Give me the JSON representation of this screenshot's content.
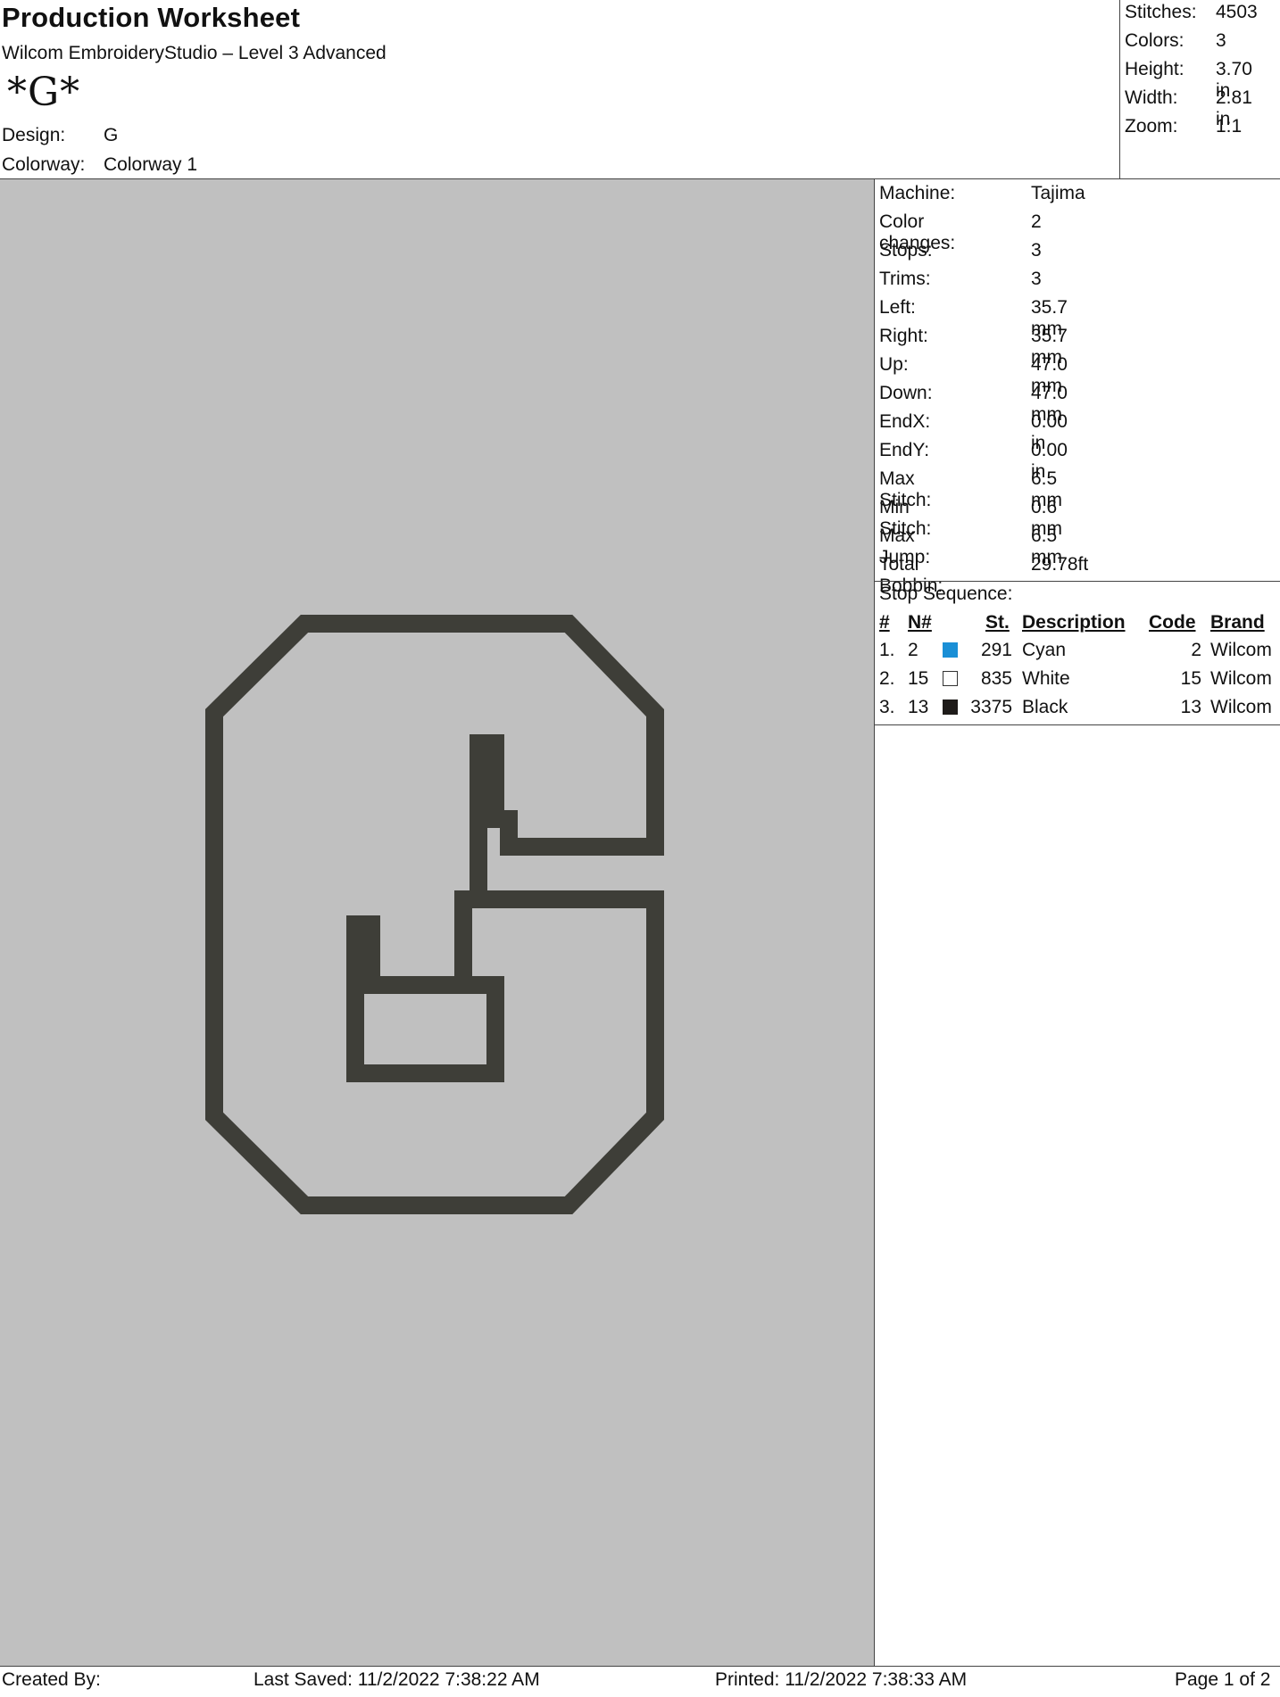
{
  "header": {
    "title": "Production Worksheet",
    "subtitle": "Wilcom EmbroideryStudio – Level 3 Advanced",
    "symbol": "*G*",
    "design_label": "Design:",
    "design_value": "G",
    "colorway_label": "Colorway:",
    "colorway_value": "Colorway 1"
  },
  "summary": [
    {
      "label": "Stitches:",
      "value": "4503"
    },
    {
      "label": "Colors:",
      "value": "3"
    },
    {
      "label": "Height:",
      "value": "3.70 in"
    },
    {
      "label": "Width:",
      "value": "2.81 in"
    },
    {
      "label": "Zoom:",
      "value": "1:1"
    }
  ],
  "info": [
    {
      "label": "Machine:",
      "value": "Tajima"
    },
    {
      "label": "Color changes:",
      "value": "2"
    },
    {
      "label": "Stops:",
      "value": "3"
    },
    {
      "label": "Trims:",
      "value": "3"
    },
    {
      "label": "Left:",
      "value": "35.7 mm"
    },
    {
      "label": "Right:",
      "value": "35.7 mm"
    },
    {
      "label": "Up:",
      "value": "47.0 mm"
    },
    {
      "label": "Down:",
      "value": "47.0 mm"
    },
    {
      "label": "EndX:",
      "value": "0.00 in"
    },
    {
      "label": "EndY:",
      "value": "0.00 in"
    },
    {
      "label": "Max Stitch:",
      "value": "6.5 mm"
    },
    {
      "label": "Min Stitch:",
      "value": "0.6 mm"
    },
    {
      "label": "Max Jump:",
      "value": "6.5 mm"
    },
    {
      "label": "Total Bobbin:",
      "value": "29.78ft"
    }
  ],
  "stop_sequence": {
    "label": "Stop Sequence:",
    "headers": {
      "num": "#",
      "n": "N#",
      "st": "St.",
      "description": "Description",
      "code": "Code",
      "brand": "Brand"
    },
    "rows": [
      {
        "num": "1.",
        "n": "2",
        "color": "#1a8fd6",
        "st": "291",
        "description": "Cyan",
        "code": "2",
        "brand": "Wilcom"
      },
      {
        "num": "2.",
        "n": "15",
        "color": "#ffffff",
        "st": "835",
        "description": "White",
        "code": "15",
        "brand": "Wilcom"
      },
      {
        "num": "3.",
        "n": "13",
        "color": "#1e1b19",
        "st": "3375",
        "description": "Black",
        "code": "13",
        "brand": "Wilcom"
      }
    ]
  },
  "design_preview": {
    "background_color": "#c0c0c0",
    "outline_color": "#3e3e38"
  },
  "footer": {
    "created_by": "Created By:",
    "last_saved": "Last Saved: 11/2/2022 7:38:22 AM",
    "printed": "Printed: 11/2/2022 7:38:33 AM",
    "page": "Page 1 of 2"
  }
}
